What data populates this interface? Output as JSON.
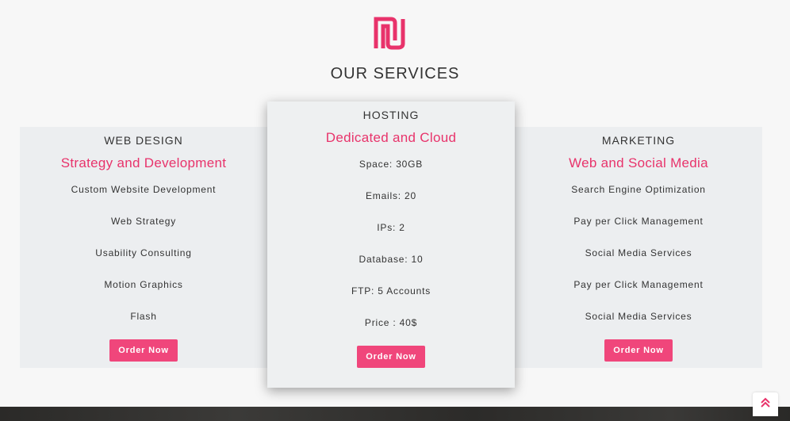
{
  "section": {
    "title": "OUR SERVICES"
  },
  "colors": {
    "accent": "#e8336b",
    "button": "#f0467b",
    "card_bg": "#eceef0",
    "page_bg": "#f7f7f7"
  },
  "cards": [
    {
      "title": "WEB DESIGN",
      "subtitle": "Strategy and Development",
      "features": [
        "Custom Website Development",
        "Web Strategy",
        "Usability Consulting",
        "Motion Graphics",
        "Flash"
      ],
      "button_label": "Order Now"
    },
    {
      "title": "HOSTING",
      "subtitle": "Dedicated and Cloud",
      "features": [
        "Space: 30GB",
        "Emails: 20",
        "IPs: 2",
        "Database: 10",
        "FTP: 5 Accounts",
        "Price : 40$"
      ],
      "button_label": "Order Now"
    },
    {
      "title": "MARKETING",
      "subtitle": "Web and Social Media",
      "features": [
        "Search Engine Optimization",
        "Pay per Click Management",
        "Social Media Services",
        "Pay per Click Management",
        "Social Media Services"
      ],
      "button_label": "Order Now"
    }
  ],
  "icons": {
    "logo": "brand-logo-icon",
    "scroll_top": "double-chevron-up-icon"
  }
}
